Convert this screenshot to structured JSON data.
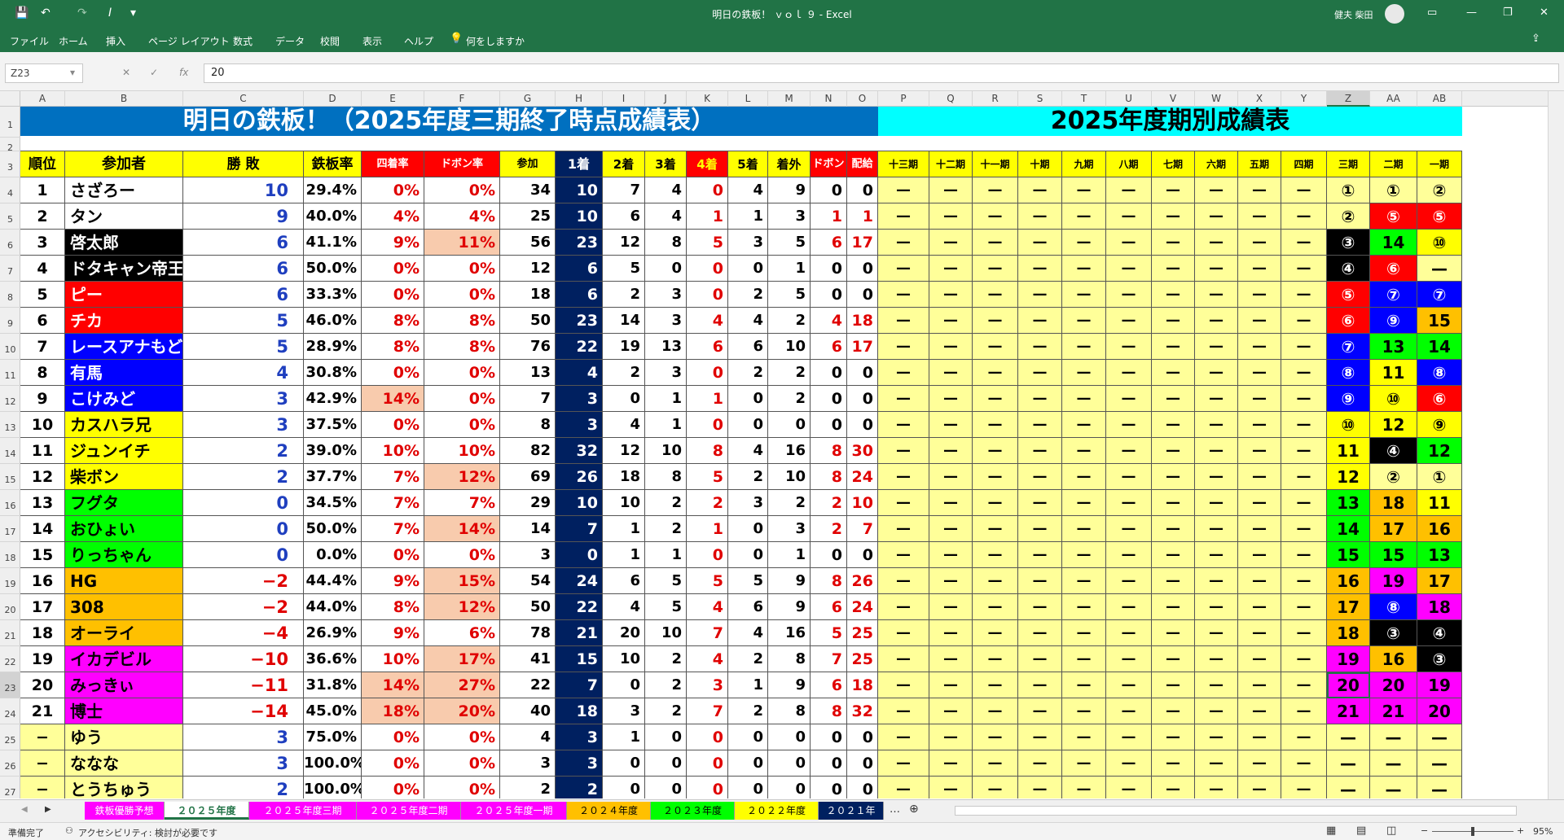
{
  "window": {
    "title": "明日の鉄板！ ｖｏｌ ９ - Excel",
    "user": "健夫 柴田"
  },
  "menu": [
    "ファイル",
    "ホーム",
    "挿入",
    "ページ レイアウト",
    "数式",
    "データ",
    "校閲",
    "表示",
    "ヘルプ",
    "何をしますか"
  ],
  "formula_bar": {
    "name_box": "Z23",
    "value": "20"
  },
  "columns": [
    "A",
    "B",
    "C",
    "D",
    "E",
    "F",
    "G",
    "H",
    "I",
    "J",
    "K",
    "L",
    "M",
    "N",
    "O",
    "P",
    "Q",
    "R",
    "S",
    "T",
    "U",
    "V",
    "W",
    "X",
    "Y",
    "Z",
    "AA",
    "AB"
  ],
  "rows": [
    "1",
    "2",
    "3",
    "4",
    "5",
    "6",
    "7",
    "8",
    "9",
    "10",
    "11",
    "12",
    "13",
    "14",
    "15",
    "16",
    "17",
    "18",
    "19",
    "20",
    "21",
    "22",
    "23",
    "24",
    "25",
    "26",
    "27"
  ],
  "banner": {
    "left": "明日の鉄板！（2025年度三期終了時点成績表）",
    "right": "2025年度期別成績表"
  },
  "headers": [
    "順位",
    "参加者",
    "勝 敗",
    "鉄板率",
    "四着率",
    "ドボン率",
    "参加",
    "1着",
    "2着",
    "3着",
    "4着",
    "5着",
    "着外",
    "ドボン",
    "配給"
  ],
  "period_headers": [
    "十三期",
    "十二期",
    "十一期",
    "十期",
    "九期",
    "八期",
    "七期",
    "六期",
    "五期",
    "四期",
    "三期",
    "二期",
    "一期"
  ],
  "dash": "—",
  "rows_data": [
    [
      "1",
      "さざろー",
      "10",
      "29.4%",
      "0%",
      "0%",
      "34",
      "10",
      "7",
      "4",
      "0",
      "4",
      "9",
      "0",
      "0",
      "①",
      "①",
      "②"
    ],
    [
      "2",
      "タン",
      "9",
      "40.0%",
      "4%",
      "4%",
      "25",
      "10",
      "6",
      "4",
      "1",
      "1",
      "3",
      "1",
      "1",
      "②",
      "⑤",
      "⑤"
    ],
    [
      "3",
      "啓太郎",
      "6",
      "41.1%",
      "9%",
      "11%",
      "56",
      "23",
      "12",
      "8",
      "5",
      "3",
      "5",
      "6",
      "17",
      "③",
      "14",
      "⑩"
    ],
    [
      "4",
      "ドタキャン帝王",
      "6",
      "50.0%",
      "0%",
      "0%",
      "12",
      "6",
      "5",
      "0",
      "0",
      "0",
      "1",
      "0",
      "0",
      "④",
      "⑥",
      "—"
    ],
    [
      "5",
      "ピー",
      "6",
      "33.3%",
      "0%",
      "0%",
      "18",
      "6",
      "2",
      "3",
      "0",
      "2",
      "5",
      "0",
      "0",
      "⑤",
      "⑦",
      "⑦"
    ],
    [
      "6",
      "チカ",
      "5",
      "46.0%",
      "8%",
      "8%",
      "50",
      "23",
      "14",
      "3",
      "4",
      "4",
      "2",
      "4",
      "18",
      "⑥",
      "⑨",
      "15"
    ],
    [
      "7",
      "レースアナもどき",
      "5",
      "28.9%",
      "8%",
      "8%",
      "76",
      "22",
      "19",
      "13",
      "6",
      "6",
      "10",
      "6",
      "17",
      "⑦",
      "13",
      "14"
    ],
    [
      "8",
      "有馬",
      "4",
      "30.8%",
      "0%",
      "0%",
      "13",
      "4",
      "2",
      "3",
      "0",
      "2",
      "2",
      "0",
      "0",
      "⑧",
      "11",
      "⑧"
    ],
    [
      "9",
      "こけみど",
      "3",
      "42.9%",
      "14%",
      "0%",
      "7",
      "3",
      "0",
      "1",
      "1",
      "0",
      "2",
      "0",
      "0",
      "⑨",
      "⑩",
      "⑥"
    ],
    [
      "10",
      "カスハラ兄",
      "3",
      "37.5%",
      "0%",
      "0%",
      "8",
      "3",
      "4",
      "1",
      "0",
      "0",
      "0",
      "0",
      "0",
      "⑩",
      "12",
      "⑨"
    ],
    [
      "11",
      "ジュンイチ",
      "2",
      "39.0%",
      "10%",
      "10%",
      "82",
      "32",
      "12",
      "10",
      "8",
      "4",
      "16",
      "8",
      "30",
      "11",
      "④",
      "12"
    ],
    [
      "12",
      "柴ボン",
      "2",
      "37.7%",
      "7%",
      "12%",
      "69",
      "26",
      "18",
      "8",
      "5",
      "2",
      "10",
      "8",
      "24",
      "12",
      "②",
      "①"
    ],
    [
      "13",
      "フグタ",
      "0",
      "34.5%",
      "7%",
      "7%",
      "29",
      "10",
      "10",
      "2",
      "2",
      "3",
      "2",
      "2",
      "10",
      "13",
      "18",
      "11"
    ],
    [
      "14",
      "おひょい",
      "0",
      "50.0%",
      "7%",
      "14%",
      "14",
      "7",
      "1",
      "2",
      "1",
      "0",
      "3",
      "2",
      "7",
      "14",
      "17",
      "16"
    ],
    [
      "15",
      "りっちゃん",
      "0",
      "0.0%",
      "0%",
      "0%",
      "3",
      "0",
      "1",
      "1",
      "0",
      "0",
      "1",
      "0",
      "0",
      "15",
      "15",
      "13"
    ],
    [
      "16",
      "HG",
      "−2",
      "44.4%",
      "9%",
      "15%",
      "54",
      "24",
      "6",
      "5",
      "5",
      "5",
      "9",
      "8",
      "26",
      "16",
      "19",
      "17"
    ],
    [
      "17",
      "308",
      "−2",
      "44.0%",
      "8%",
      "12%",
      "50",
      "22",
      "4",
      "5",
      "4",
      "6",
      "9",
      "6",
      "24",
      "17",
      "⑧",
      "18"
    ],
    [
      "18",
      "オーライ",
      "−4",
      "26.9%",
      "9%",
      "6%",
      "78",
      "21",
      "20",
      "10",
      "7",
      "4",
      "16",
      "5",
      "25",
      "18",
      "③",
      "④"
    ],
    [
      "19",
      "イカデビル",
      "−10",
      "36.6%",
      "10%",
      "17%",
      "41",
      "15",
      "10",
      "2",
      "4",
      "2",
      "8",
      "7",
      "25",
      "19",
      "16",
      "③"
    ],
    [
      "20",
      "みっきぃ",
      "−11",
      "31.8%",
      "14%",
      "27%",
      "22",
      "7",
      "0",
      "2",
      "3",
      "1",
      "9",
      "6",
      "18",
      "20",
      "20",
      "19"
    ],
    [
      "21",
      "博士",
      "−14",
      "45.0%",
      "18%",
      "20%",
      "40",
      "18",
      "3",
      "2",
      "7",
      "2",
      "8",
      "8",
      "32",
      "21",
      "21",
      "20"
    ],
    [
      "−",
      "ゆう",
      "3",
      "75.0%",
      "0%",
      "0%",
      "4",
      "3",
      "1",
      "0",
      "0",
      "0",
      "0",
      "0",
      "0",
      "—",
      "—",
      "—"
    ],
    [
      "−",
      "ななな",
      "3",
      "100.0%",
      "0%",
      "0%",
      "3",
      "3",
      "0",
      "0",
      "0",
      "0",
      "0",
      "0",
      "0",
      "—",
      "—",
      "—"
    ],
    [
      "−",
      "とうちゅう",
      "2",
      "100.0%",
      "0%",
      "0%",
      "2",
      "2",
      "0",
      "0",
      "0",
      "0",
      "0",
      "0",
      "0",
      "—",
      "—",
      "—"
    ]
  ],
  "colors": {
    "green": "#217346",
    "header_blue": "#0070c0",
    "cyan": "#00ffff",
    "yellow": "#ffff00",
    "navy": "#002060",
    "red": "#ff0000",
    "salmon": "#f8cbad",
    "light_yellow": "#ffff99",
    "orange": "#ffc000",
    "magenta": "#ff00ff",
    "lime": "#00ff00",
    "blue": "#0000ff",
    "black": "#000000"
  },
  "sheet_tabs": [
    "鉄板優勝予想",
    "２０２５年度",
    "２０２５年度三期",
    "２０２５年度二期",
    "２０２５年度一期",
    "２０２４年度",
    "２０２３年度",
    "２０２２年度",
    "２０２１年"
  ],
  "status": {
    "ready": "準備完了",
    "accessibility": "アクセシビリティ: 検討が必要です",
    "zoom": "95%"
  }
}
